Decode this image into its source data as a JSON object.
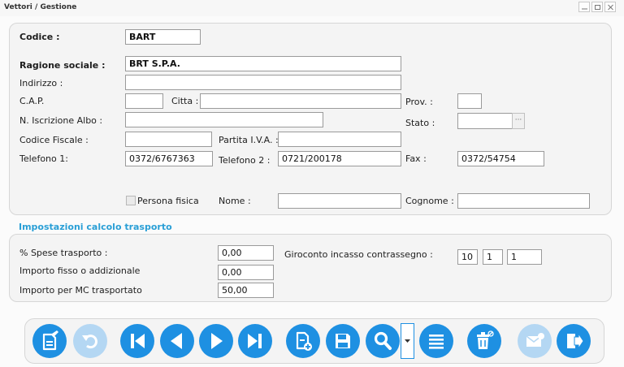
{
  "window": {
    "title": "Vettori / Gestione"
  },
  "form": {
    "codice": {
      "label": "Codice :",
      "value": "BART"
    },
    "ragione_sociale": {
      "label": "Ragione sociale :",
      "value": "BRT S.P.A."
    },
    "indirizzo": {
      "label": "Indirizzo :",
      "value": ""
    },
    "cap": {
      "label": "C.A.P.",
      "value": ""
    },
    "citta": {
      "label": "Citta :",
      "value": ""
    },
    "prov": {
      "label": "Prov. :",
      "value": ""
    },
    "iscrizione_albo": {
      "label": "N. Iscrizione Albo :",
      "value": ""
    },
    "stato": {
      "label": "Stato :",
      "value": ""
    },
    "codice_fiscale": {
      "label": "Codice Fiscale :",
      "value": ""
    },
    "partita_iva": {
      "label": "Partita I.V.A. :",
      "value": ""
    },
    "telefono1": {
      "label": "Telefono 1:",
      "value": "0372/6767363"
    },
    "telefono2": {
      "label": "Telefono 2 :",
      "value": "0721/200178"
    },
    "fax": {
      "label": "Fax :",
      "value": "0372/54754"
    },
    "persona_fisica": {
      "label": "Persona fisica",
      "checked": false
    },
    "nome": {
      "label": "Nome :",
      "value": ""
    },
    "cognome": {
      "label": "Cognome :",
      "value": ""
    }
  },
  "trasporto": {
    "section_title": "Impostazioni calcolo trasporto",
    "spese": {
      "label": "% Spese trasporto :",
      "value": "0,00"
    },
    "importo_fisso": {
      "label": "Importo fisso o addizionale",
      "value": "0,00"
    },
    "importo_mc": {
      "label": "Importo per MC trasportato",
      "value": "50,00"
    },
    "giroconto": {
      "label": "Giroconto incasso contrassegno :",
      "values": [
        "10",
        "1",
        "1"
      ]
    }
  },
  "colors": {
    "accent": "#1e90e2",
    "accent_disabled": "#b4d7f3",
    "section_title": "#2a9fd6"
  },
  "toolbar": [
    {
      "icon": "edit-document-icon",
      "enabled": true
    },
    {
      "icon": "undo-icon",
      "enabled": false
    },
    {
      "icon": "first-record-icon",
      "enabled": true
    },
    {
      "icon": "previous-record-icon",
      "enabled": true
    },
    {
      "icon": "next-record-icon",
      "enabled": true
    },
    {
      "icon": "last-record-icon",
      "enabled": true
    },
    {
      "icon": "new-document-icon",
      "enabled": true
    },
    {
      "icon": "save-icon",
      "enabled": true
    },
    {
      "icon": "search-icon",
      "enabled": true
    },
    {
      "icon": "chevron-down-icon",
      "enabled": true
    },
    {
      "icon": "list-icon",
      "enabled": true
    },
    {
      "icon": "delete-icon",
      "enabled": true
    },
    {
      "icon": "email-icon",
      "enabled": false
    },
    {
      "icon": "exit-icon",
      "enabled": true
    }
  ]
}
